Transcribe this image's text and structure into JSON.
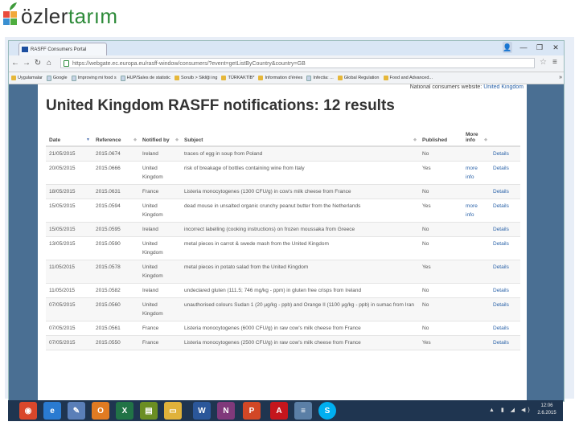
{
  "slide": {
    "logo_part1": "özler",
    "logo_part2": "tarım"
  },
  "browser": {
    "tab_title": "RASFF Consumers Portal",
    "tab_close": "x",
    "url": "https://webgate.ec.europa.eu/rasff-window/consumers/?event=getListByCountry&country=GB",
    "bookmarks": [
      "Uygulamalar",
      "Google",
      "Improving mi food s",
      "HUP/Sales de statistic",
      "Sorulb > Sikliği ing",
      "TÜRKAKTİB*",
      "Information d'érées",
      "Infectia: ...",
      "Global Regulation",
      "Food and Advanced..."
    ],
    "more_bookmarks": "»",
    "window_controls": [
      "—",
      "❐",
      "✕"
    ]
  },
  "page": {
    "national_label": "National consumers website:",
    "national_link": "United Kingdom",
    "title": "United Kingdom RASFF notifications: 12 results",
    "columns": {
      "date": "Date",
      "reference": "Reference",
      "notified_by": "Notified by",
      "subject": "Subject",
      "published": "Published",
      "more_info": "More info"
    },
    "rows": [
      {
        "date": "21/05/2015",
        "reference": "2015.0674",
        "notified_by": "Ireland",
        "subject": "traces of egg in soup from Poland",
        "published": "No",
        "more_info": "",
        "details": "Details"
      },
      {
        "date": "20/05/2015",
        "reference": "2015.0666",
        "notified_by": "United Kingdom",
        "subject": "risk of breakage of bottles containing wine from Italy",
        "published": "Yes",
        "more_info": "more info",
        "details": "Details"
      },
      {
        "date": "18/05/2015",
        "reference": "2015.0631",
        "notified_by": "France",
        "subject": "Listeria monocytogenes (1300 CFU/g) in cow's milk cheese from France",
        "published": "No",
        "more_info": "",
        "details": "Details"
      },
      {
        "date": "15/05/2015",
        "reference": "2015.0594",
        "notified_by": "United Kingdom",
        "subject": "dead mouse in unsalted organic crunchy peanut butter from the Netherlands",
        "published": "Yes",
        "more_info": "more info",
        "details": "Details"
      },
      {
        "date": "15/05/2015",
        "reference": "2015.0595",
        "notified_by": "Ireland",
        "subject": "incorrect labelling (cooking instructions) on frozen moussaka from Greece",
        "published": "No",
        "more_info": "",
        "details": "Details"
      },
      {
        "date": "13/05/2015",
        "reference": "2015.0590",
        "notified_by": "United Kingdom",
        "subject": "metal pieces in carrot & swede mash from the United Kingdom",
        "published": "No",
        "more_info": "",
        "details": "Details"
      },
      {
        "date": "11/05/2015",
        "reference": "2015.0578",
        "notified_by": "United Kingdom",
        "subject": "metal pieces in potato salad from the United Kingdom",
        "published": "Yes",
        "more_info": "",
        "details": "Details"
      },
      {
        "date": "11/05/2015",
        "reference": "2015.0582",
        "notified_by": "Ireland",
        "subject": "undeclared gluten (111.5; 746 mg/kg - ppm) in gluten free crisps from Ireland",
        "published": "No",
        "more_info": "",
        "details": "Details"
      },
      {
        "date": "07/05/2015",
        "reference": "2015.0560",
        "notified_by": "United Kingdom",
        "subject": "unauthorised colours Sudan 1 (20 µg/kg - ppb) and Orange II (1100 µg/kg - ppb) in sumac from Iran",
        "published": "No",
        "more_info": "",
        "details": "Details"
      },
      {
        "date": "07/05/2015",
        "reference": "2015.0561",
        "notified_by": "France",
        "subject": "Listeria monocytogenes (6000 CFU/g) in raw cow's milk cheese from France",
        "published": "No",
        "more_info": "",
        "details": "Details"
      },
      {
        "date": "07/05/2015",
        "reference": "2015.0550",
        "notified_by": "France",
        "subject": "Listeria monocytogenes (2500 CFU/g) in raw cow's milk cheese from France",
        "published": "Yes",
        "more_info": "",
        "details": "Details"
      }
    ]
  },
  "taskbar": {
    "apps": [
      {
        "name": "chrome",
        "label": "◉",
        "color": "#d9472b"
      },
      {
        "name": "internet-explorer",
        "label": "e",
        "color": "#2a7bd1"
      },
      {
        "name": "paint",
        "label": "✎",
        "color": "#5a7fb8"
      },
      {
        "name": "outlook",
        "label": "O",
        "color": "#e07b22"
      },
      {
        "name": "excel",
        "label": "X",
        "color": "#217346"
      },
      {
        "name": "notes",
        "label": "▤",
        "color": "#6b8e23"
      },
      {
        "name": "file-explorer",
        "label": "▭",
        "color": "#e0b23a"
      },
      {
        "name": "word",
        "label": "W",
        "color": "#2b579a"
      },
      {
        "name": "onenote",
        "label": "N",
        "color": "#80397b"
      },
      {
        "name": "powerpoint",
        "label": "P",
        "color": "#d24726"
      },
      {
        "name": "acrobat",
        "label": "A",
        "color": "#c5161d"
      },
      {
        "name": "notepad",
        "label": "≡",
        "color": "#5b7fa6"
      },
      {
        "name": "skype",
        "label": "S",
        "color": "#00aff0"
      }
    ],
    "time": "12:06",
    "date": "2.6.2015"
  }
}
